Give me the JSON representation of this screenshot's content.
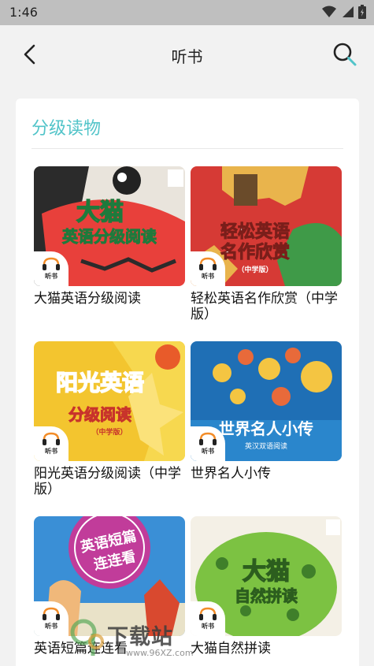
{
  "status_bar": {
    "time": "1:46",
    "icons": [
      "wifi-icon",
      "signal-icon",
      "battery-icon"
    ]
  },
  "app_bar": {
    "title": "听书",
    "back_icon": "back-arrow-icon",
    "search_icon": "search-icon"
  },
  "section": {
    "title": "分级读物"
  },
  "badge_label": "听书",
  "books": [
    {
      "title": "大猫英语分级阅读",
      "cover_text": [
        "大猫",
        "英语分级阅读"
      ]
    },
    {
      "title": "轻松英语名作欣赏（中学版）",
      "cover_text": [
        "轻松英语",
        "名作欣赏",
        "（中学版）"
      ]
    },
    {
      "title": "阳光英语分级阅读（中学版）",
      "cover_text": [
        "阳光英语",
        "分级阅读",
        "（中学版）"
      ]
    },
    {
      "title": "世界名人小传",
      "cover_text": [
        "世界名人小传",
        "英汉双语阅读"
      ]
    },
    {
      "title": "英语短篇连连看",
      "cover_text": [
        "英语短篇",
        "连连看"
      ]
    },
    {
      "title": "大猫自然拼读",
      "cover_text": [
        "大猫",
        "自然拼读"
      ]
    }
  ],
  "watermark": {
    "text": "下载站",
    "url": "www.96XZ.com"
  },
  "colors": {
    "accent": "#52c4c9",
    "status_bar": "#bfbfbf",
    "background": "#f2f2f2"
  }
}
